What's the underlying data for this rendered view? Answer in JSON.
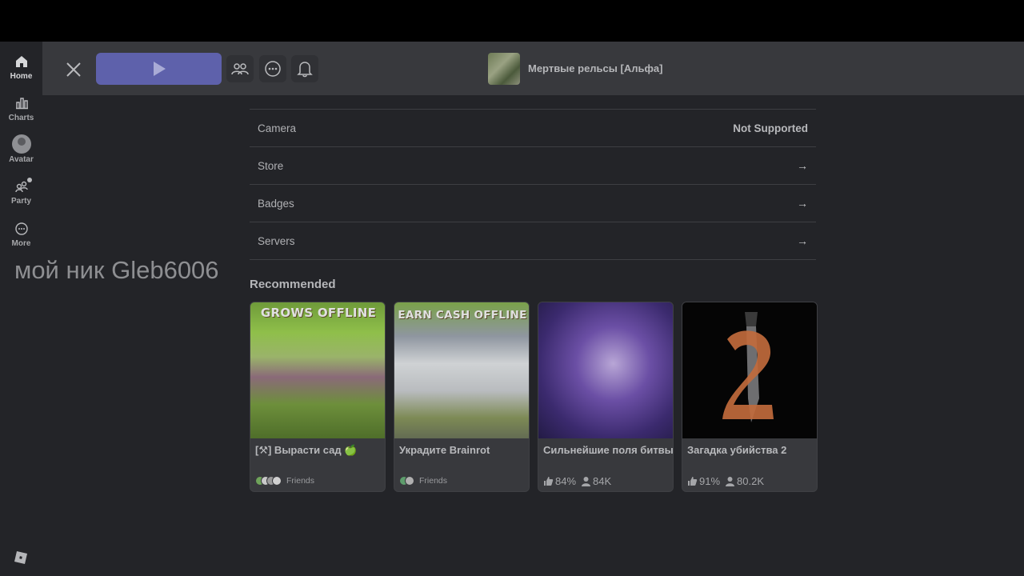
{
  "leftnav": {
    "items": [
      {
        "label": "Home",
        "icon": "home-icon"
      },
      {
        "label": "Charts",
        "icon": "charts-icon"
      },
      {
        "label": "Avatar",
        "icon": "avatar-icon"
      },
      {
        "label": "Party",
        "icon": "party-icon"
      },
      {
        "label": "More",
        "icon": "more-icon"
      }
    ]
  },
  "topbar": {
    "game_title": "Мертвые рельсы [Альфа]"
  },
  "rows": [
    {
      "label": "Camera",
      "value": "Not Supported"
    },
    {
      "label": "Store",
      "value": "→"
    },
    {
      "label": "Badges",
      "value": "→"
    },
    {
      "label": "Servers",
      "value": "→"
    }
  ],
  "overlay_text": "мой ник Gleb6006",
  "recommended": {
    "title": "Recommended",
    "cards": [
      {
        "name": "[⚒] Вырасти сад 🍏",
        "caption": "GROWS OFFLINE",
        "meta": "Friends"
      },
      {
        "name": "Украдите Brainrot",
        "caption": "EARN CASH OFFLINE",
        "meta": "Friends"
      },
      {
        "name": "Сильнейшие поля битвы",
        "rating": "84%",
        "players": "84K"
      },
      {
        "name": "Загадка убийства 2",
        "rating": "91%",
        "players": "80.2K"
      }
    ]
  },
  "colors": {
    "accent": "#5e61ab",
    "background": "#232428",
    "header": "#38393d"
  }
}
